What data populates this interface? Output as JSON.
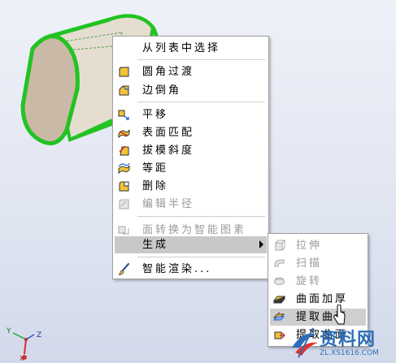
{
  "context_menu": {
    "items": [
      {
        "label": "从列表中选择",
        "icon": "none",
        "enabled": true
      },
      {
        "label": "圆角过渡",
        "icon": "fillet-icon",
        "enabled": true
      },
      {
        "label": "边倒角",
        "icon": "chamfer-icon",
        "enabled": true
      },
      {
        "label": "平移",
        "icon": "move-icon",
        "enabled": true
      },
      {
        "label": "表面匹配",
        "icon": "surface-match-icon",
        "enabled": true
      },
      {
        "label": "拔模斜度",
        "icon": "draft-icon",
        "enabled": true
      },
      {
        "label": "等距",
        "icon": "offset-icon",
        "enabled": true
      },
      {
        "label": "删除",
        "icon": "delete-face-icon",
        "enabled": true
      },
      {
        "label": "编辑半径",
        "icon": "edit-radius-icon",
        "enabled": false
      },
      {
        "label": "面转换为智能图素",
        "icon": "convert-face-icon",
        "enabled": false
      },
      {
        "label": "生成",
        "icon": "none",
        "enabled": true,
        "submenu": true
      },
      {
        "label": "智能渲染...",
        "icon": "brush-icon",
        "enabled": true
      }
    ]
  },
  "sub_menu": {
    "items": [
      {
        "label": "拉伸",
        "icon": "extrude-icon",
        "enabled": false
      },
      {
        "label": "扫描",
        "icon": "sweep-icon",
        "enabled": false
      },
      {
        "label": "旋转",
        "icon": "revolve-icon",
        "enabled": false
      },
      {
        "label": "曲面加厚",
        "icon": "thicken-icon",
        "enabled": true
      },
      {
        "label": "提取曲面",
        "icon": "extract-surface-icon",
        "enabled": true
      },
      {
        "label": "提取曲面",
        "icon": "extract-curve-icon",
        "enabled": true
      }
    ]
  },
  "axis": {
    "x": "X",
    "y": "Y",
    "z": "Z"
  },
  "watermark": {
    "title": "资料网",
    "url": "ZL.XS1616.COM"
  },
  "colors": {
    "highlight_green": "#22c322",
    "part_face": "#c9b9a6",
    "menu_bg": "#ffffff"
  }
}
